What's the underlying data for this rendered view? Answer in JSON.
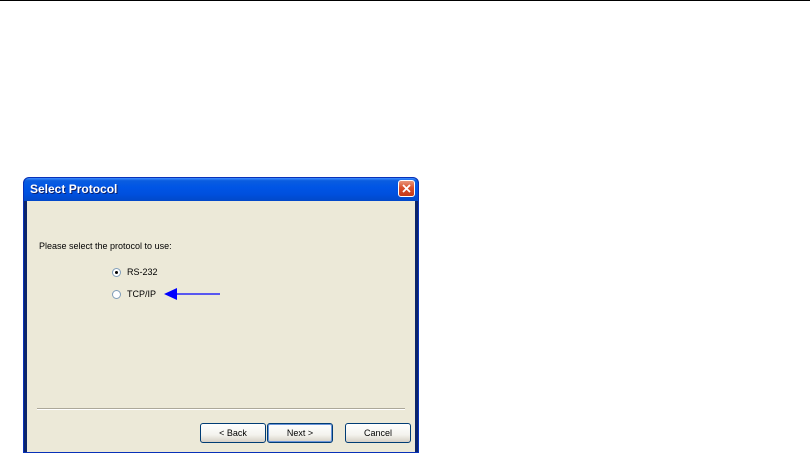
{
  "dialog": {
    "title": "Select Protocol",
    "prompt": "Please select the protocol to use:",
    "options": [
      {
        "label": "RS-232",
        "selected": true
      },
      {
        "label": "TCP/IP",
        "selected": false
      }
    ],
    "buttons": {
      "back": "< Back",
      "next": "Next >",
      "cancel": "Cancel"
    },
    "close_icon": "close-icon",
    "annotation_icon": "arrow-left-icon",
    "colors": {
      "titlebar": "#0055e5",
      "body": "#ece9d8",
      "close": "#d9502c",
      "annotation_arrow": "#0000ff"
    }
  }
}
